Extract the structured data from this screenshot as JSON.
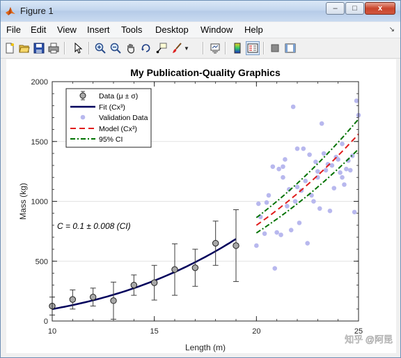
{
  "window": {
    "title": "Figure 1",
    "minimize_label": "–",
    "maximize_label": "□",
    "close_label": "x"
  },
  "menu": {
    "items": [
      "File",
      "Edit",
      "View",
      "Insert",
      "Tools",
      "Desktop",
      "Window",
      "Help"
    ]
  },
  "toolbar": {
    "buttons": [
      {
        "name": "new-figure-icon"
      },
      {
        "name": "open-file-icon"
      },
      {
        "name": "save-icon"
      },
      {
        "name": "print-icon"
      },
      {
        "name": "edit-plot-arrow-icon"
      },
      {
        "name": "zoom-in-icon"
      },
      {
        "name": "zoom-out-icon"
      },
      {
        "name": "pan-hand-icon"
      },
      {
        "name": "rotate-3d-icon"
      },
      {
        "name": "data-cursor-icon"
      },
      {
        "name": "brush-icon"
      },
      {
        "name": "link-plot-icon"
      },
      {
        "name": "insert-colorbar-icon"
      },
      {
        "name": "insert-legend-icon"
      },
      {
        "name": "hide-plot-tools-icon"
      },
      {
        "name": "show-plot-tools-icon"
      }
    ]
  },
  "chart_data": {
    "type": "scatter",
    "title": "My Publication-Quality Graphics",
    "xlabel": "Length (m)",
    "ylabel": "Mass (kg)",
    "xlim": [
      10,
      25
    ],
    "ylim": [
      0,
      2000
    ],
    "xticks": [
      "10",
      "15",
      "20",
      "25"
    ],
    "yticks": [
      "0",
      "500",
      "1000",
      "1500",
      "2000"
    ],
    "grid": "y-major",
    "legend_position": "top-left",
    "annotation": "C = 0.1 ± 0.008 (CI)",
    "legend": [
      {
        "label": "Data (μ ± σ)",
        "kind": "errorbar"
      },
      {
        "label": "Fit (Cx³)",
        "kind": "solid-line"
      },
      {
        "label": "Validation Data",
        "kind": "dot"
      },
      {
        "label": "Model (Cx³)",
        "kind": "dashed-line"
      },
      {
        "label": "95% CI",
        "kind": "dashdot-line"
      }
    ],
    "colors": {
      "fit": "#00005c",
      "validation": "#b8b8ee",
      "model": "#e01c1c",
      "ci": "#007200",
      "data_marker": "#a8a8a8"
    },
    "series": [
      {
        "name": "Data (μ ± σ)",
        "x": [
          10,
          11,
          12,
          13,
          14,
          15,
          16,
          17,
          18,
          19
        ],
        "y": [
          125,
          180,
          200,
          170,
          300,
          320,
          430,
          445,
          650,
          630
        ],
        "error": [
          75,
          80,
          75,
          155,
          85,
          145,
          215,
          155,
          185,
          300
        ]
      },
      {
        "name": "Fit (Cx³)",
        "curve": "0.1*x^3",
        "x_range": [
          10,
          19
        ]
      },
      {
        "name": "Validation Data",
        "x": [
          20.0,
          20.1,
          20.2,
          20.4,
          20.5,
          20.6,
          20.8,
          20.9,
          21.0,
          21.1,
          21.2,
          21.3,
          21.4,
          21.5,
          21.6,
          21.7,
          21.8,
          21.9,
          22.0,
          22.1,
          22.2,
          22.3,
          22.4,
          22.5,
          22.6,
          22.7,
          22.8,
          22.9,
          23.0,
          23.1,
          23.2,
          23.3,
          23.4,
          23.5,
          23.6,
          23.7,
          23.8,
          23.9,
          24.0,
          24.1,
          24.2,
          24.3,
          24.4,
          24.5,
          24.6,
          24.7,
          24.8,
          24.9,
          25.0,
          21.3,
          22.0,
          23.0,
          24.2
        ],
        "y": [
          630,
          980,
          870,
          730,
          990,
          1050,
          1290,
          440,
          740,
          1270,
          720,
          1200,
          1350,
          960,
          1100,
          760,
          1790,
          1000,
          1440,
          820,
          1090,
          1440,
          1170,
          650,
          1390,
          1050,
          1000,
          1330,
          1200,
          940,
          1650,
          1400,
          1260,
          1310,
          920,
          1300,
          1110,
          1370,
          1350,
          1240,
          1200,
          1140,
          1270,
          1340,
          1260,
          1380,
          910,
          1840,
          1720,
          1290,
          1120,
          1250,
          1480
        ]
      },
      {
        "name": "Model (Cx³)",
        "curve": "0.1*x^3",
        "x_range": [
          20,
          25
        ]
      },
      {
        "name": "95% CI",
        "curves": [
          "0.108*x^3",
          "0.092*x^3"
        ],
        "x_range": [
          20,
          25
        ]
      }
    ]
  },
  "watermark": "知乎 @阿昆"
}
